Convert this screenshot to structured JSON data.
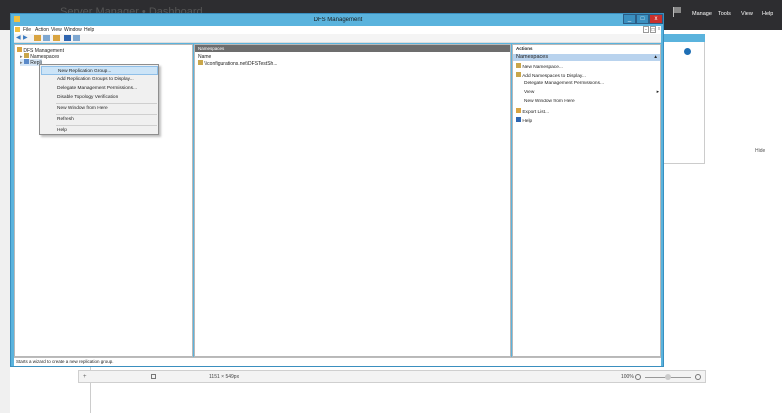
{
  "server_manager": {
    "title": "Server Manager • Dashboard",
    "menu": [
      "Manage",
      "Tools",
      "View",
      "Help"
    ],
    "hide_label": "Hide"
  },
  "window": {
    "title": "DFS Management",
    "menu": [
      "File",
      "Action",
      "View",
      "Window",
      "Help"
    ],
    "controls": [
      "_",
      "□",
      "x"
    ],
    "inner_controls": [
      "-",
      "□",
      "x"
    ]
  },
  "tree": {
    "root": "DFS Management",
    "namespaces": "Namespaces",
    "replication": "Repli"
  },
  "context_menu": {
    "items": [
      "New Replication Group...",
      "Add Replication Groups to Display...",
      "Delegate Management Permissions...",
      "Disable Topology Verification",
      "New Window from Here",
      "Refresh",
      "Help"
    ]
  },
  "center": {
    "header": "Namespaces",
    "column": "Name",
    "row": "\\\\configurations.net\\DFSTestSh..."
  },
  "actions": {
    "header": "Actions",
    "section": "Namespaces",
    "items": [
      "New Namespace...",
      "Add Namespaces to Display...",
      "Delegate Management Permissions...",
      "View",
      "New Window from Here",
      "Export List...",
      "Help"
    ]
  },
  "status_text": "Starts a wizard to create a new replication group.",
  "bottom_bar": {
    "dims": "1151 × 549px",
    "zoom": "100%"
  },
  "colors": {
    "title_bar": "#5ab3dd",
    "close_button": "#c9302c",
    "accent": "#1e6fb5"
  }
}
